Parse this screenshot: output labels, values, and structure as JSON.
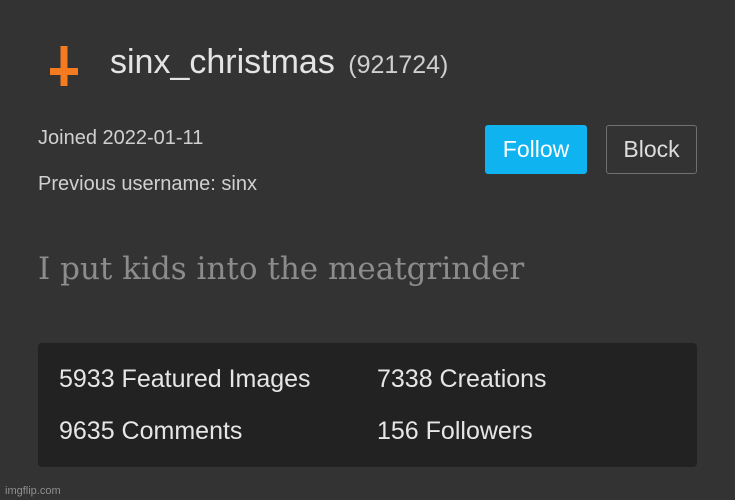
{
  "profile": {
    "username": "sinx_christmas",
    "user_id": "(921724)",
    "joined": "Joined 2022-01-11",
    "previous_username": "Previous username: sinx",
    "bio": "I put kids into the meatgrinder",
    "avatar_icon": "inverted-cross-icon",
    "accent_color": "#f47b20"
  },
  "actions": {
    "follow_label": "Follow",
    "block_label": "Block",
    "follow_color": "#0fb3ef"
  },
  "stats": {
    "featured": "5933 Featured Images",
    "creations": "7338 Creations",
    "comments": "9635 Comments",
    "followers": "156 Followers"
  },
  "footer": {
    "watermark": "imgflip.com"
  }
}
